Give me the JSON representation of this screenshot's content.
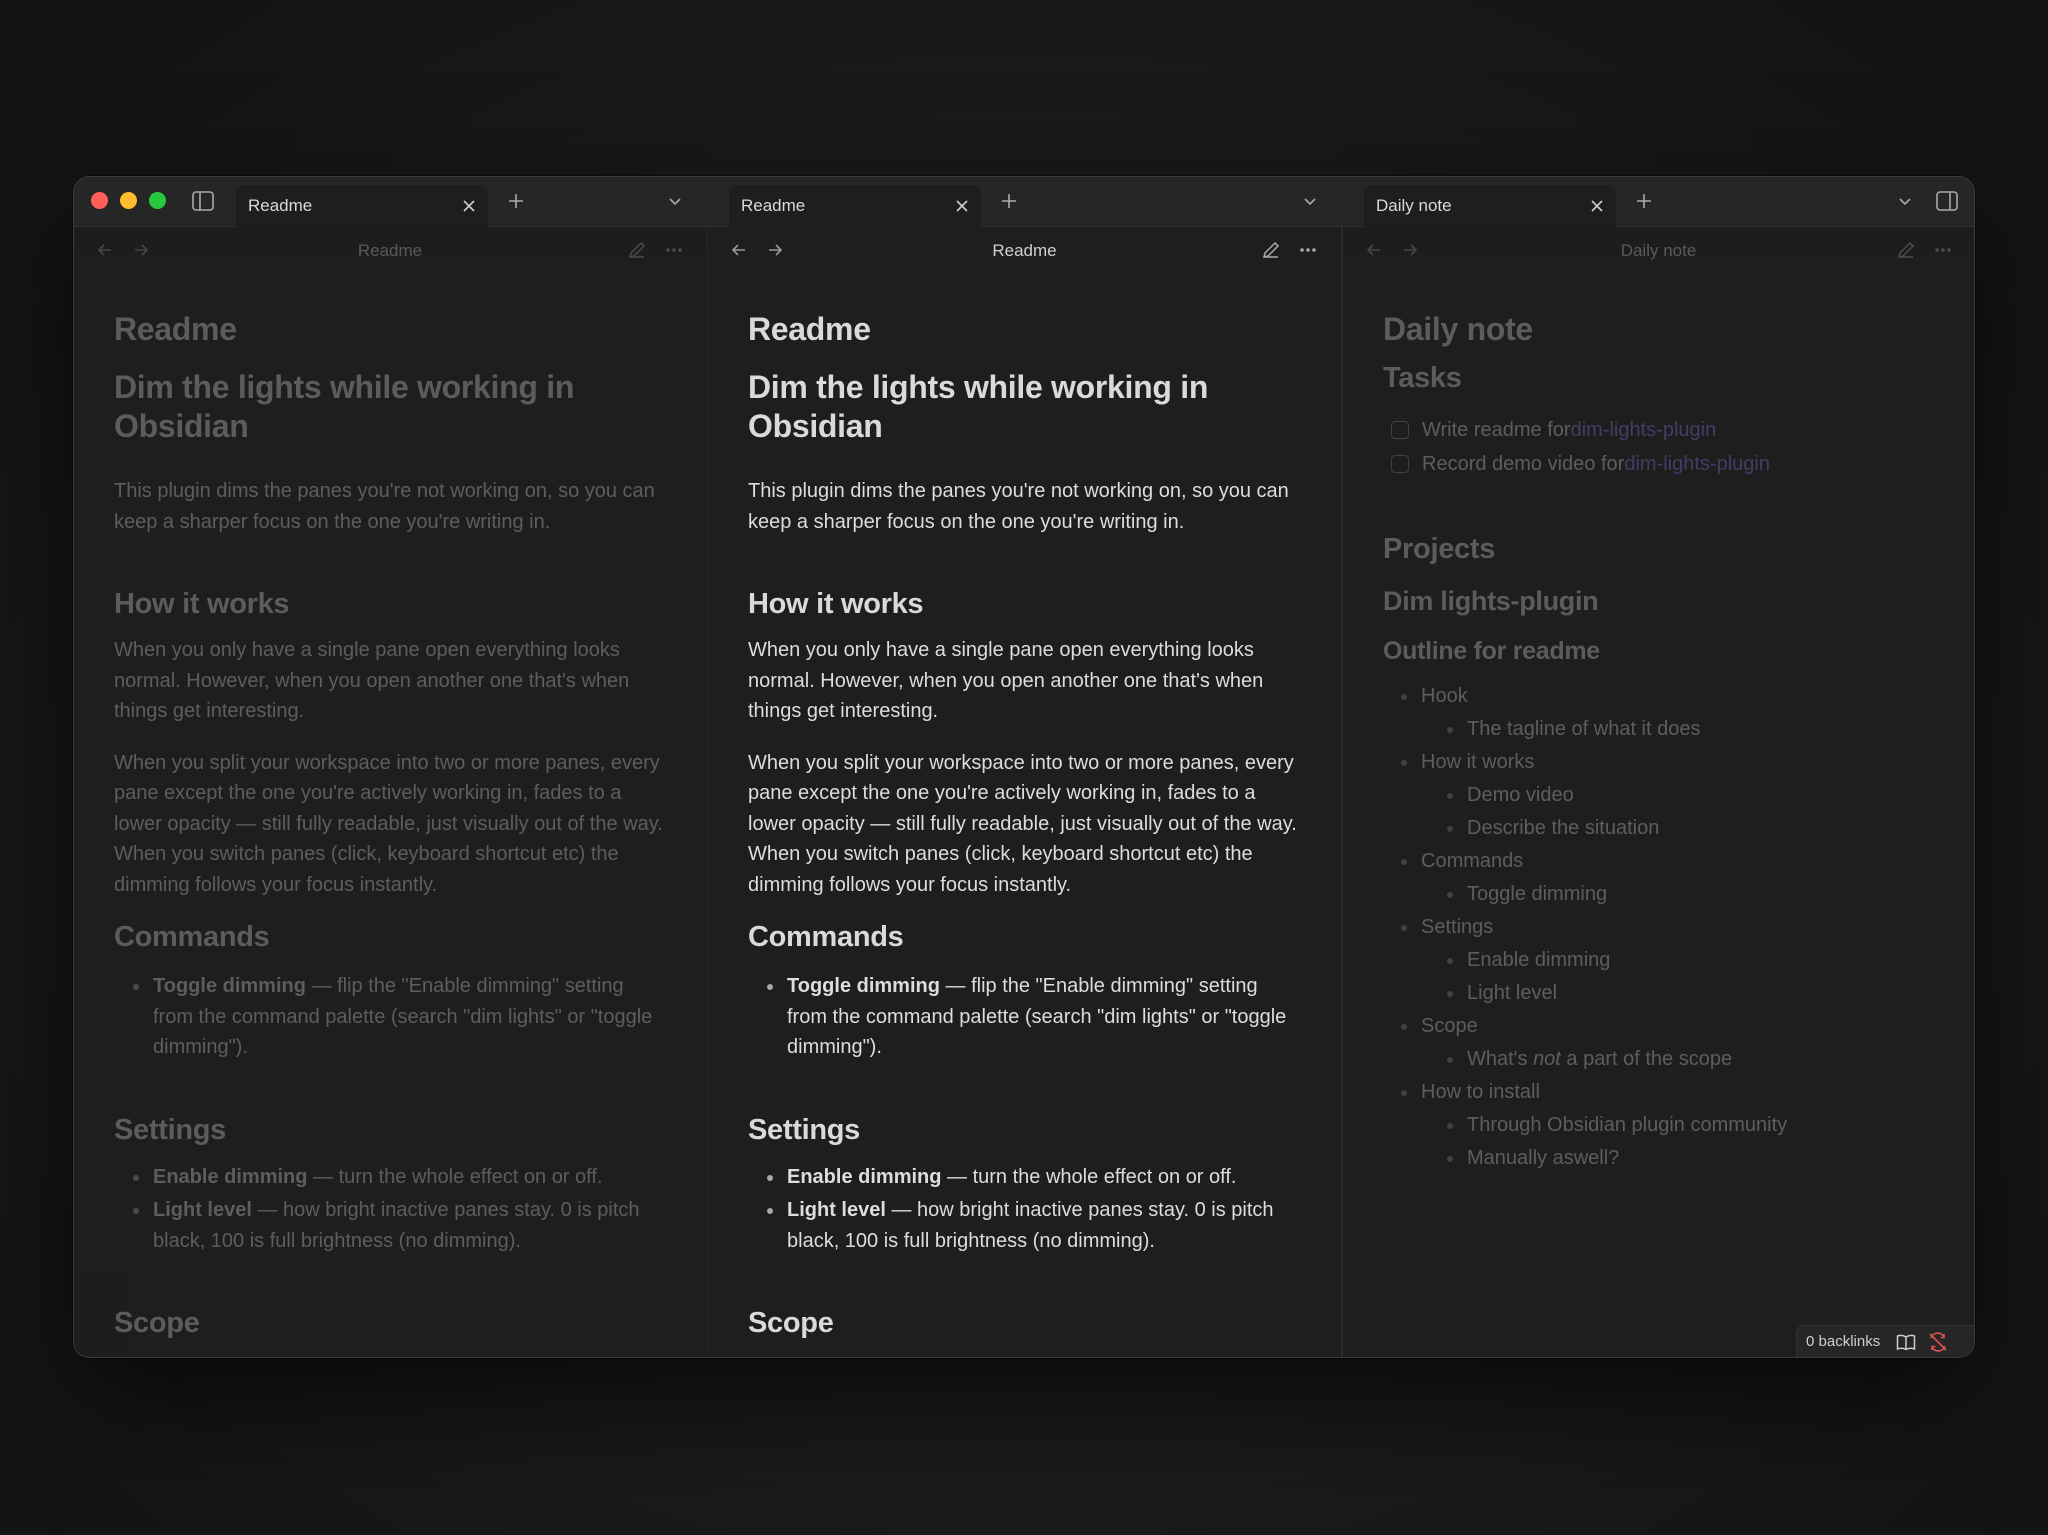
{
  "tabs": [
    {
      "label": "Readme"
    },
    {
      "label": "Readme"
    },
    {
      "label": "Daily note"
    }
  ],
  "panes": {
    "left": {
      "title": "Readme",
      "state": "dimmed"
    },
    "middle": {
      "title": "Readme",
      "state": "active"
    },
    "right": {
      "title": "Daily note",
      "state": "dimmed"
    }
  },
  "readme": {
    "inline_title": "Readme",
    "h1": "Dim the lights while working in Obsidian",
    "intro": "This plugin dims the panes you're not working on, so you can keep a sharper focus on the one you're writing in.",
    "how_heading": "How it works",
    "how_p1": "When you only have a single pane open everything looks normal. However, when you open another one that's when things get interesting.",
    "how_p2": "When you split your workspace into two or more panes, every pane except the one you're actively working in, fades to a lower opacity — still fully readable, just visually out of the way. When you switch panes (click, keyboard shortcut etc) the dimming follows your focus instantly.",
    "commands_heading": "Commands",
    "cmd_name": "Toggle dimming",
    "cmd_desc": " — flip the \"Enable dimming\" setting from the command palette (search \"dim lights\" or \"toggle dimming\").",
    "settings_heading": "Settings",
    "set1_name": "Enable dimming",
    "set1_desc": " — turn the whole effect on or off.",
    "set2_name": "Light level",
    "set2_desc": " — how bright inactive panes stay. 0 is pitch black, 100 is full brightness (no dimming).",
    "scope_heading": "Scope"
  },
  "daily": {
    "inline_title": "Daily note",
    "tasks_heading": "Tasks",
    "tasks": [
      {
        "text": "Write readme for ",
        "link": "dim-lights-plugin",
        "checked": false
      },
      {
        "text": "Record demo video for ",
        "link": "dim-lights-plugin",
        "checked": false
      }
    ],
    "projects_heading": "Projects",
    "project_heading": "Dim lights-plugin",
    "outline_heading": "Outline for readme",
    "outline": [
      {
        "label": "Hook",
        "children": [
          "The tagline of what it does"
        ]
      },
      {
        "label": "How it works",
        "children": [
          "Demo video",
          "Describe the situation"
        ]
      },
      {
        "label": "Commands",
        "children": [
          "Toggle dimming"
        ]
      },
      {
        "label": "Settings",
        "children": [
          "Enable dimming",
          "Light level"
        ]
      },
      {
        "label": "Scope",
        "children_rich": [
          {
            "pre": "What's ",
            "em": "not",
            "post": " a part of the scope"
          }
        ]
      },
      {
        "label": "How to install",
        "children": [
          "Through Obsidian plugin community",
          "Manually aswell?"
        ]
      }
    ]
  },
  "status_bar": {
    "backlinks": "0 backlinks"
  },
  "colors": {
    "accent_link": "#8b7cf6",
    "window_bg": "#1e1e1e",
    "tabbar_bg": "#262626"
  }
}
